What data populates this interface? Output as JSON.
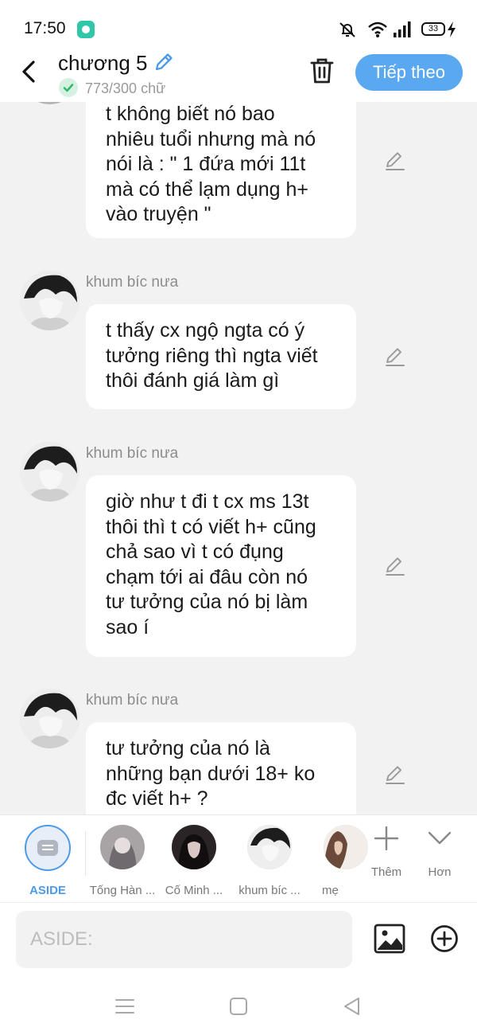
{
  "status_bar": {
    "time": "17:50",
    "battery": "33"
  },
  "header": {
    "title": "chương 5",
    "char_count": "773/300 chữ",
    "next_label": "Tiếp theo"
  },
  "messages": [
    {
      "text": "t không biết nó bao\nnhiêu tuổi nhưng mà nó\nnói là : \" 1 đứa mới 11t\nmà có thể lạm dụng h+\nvào truyện \""
    },
    {
      "sender": "khum bíc nưa",
      "text": "t thấy cx ngộ ngta có ý\ntưởng riêng thì ngta viết\nthôi đánh giá làm gì"
    },
    {
      "sender": "khum bíc nưa",
      "text": "giờ như t đi t cx ms 13t\nthôi thì t có viết h+ cũng\nchả sao vì t có đụng\nchạm tới ai đâu còn nó\ntư tưởng của nó bị làm\nsao í"
    },
    {
      "sender": "khum bíc nưa",
      "text": "tư tưởng của nó là\nnhững bạn dưới 18+ ko\nđc viết h+ ?"
    }
  ],
  "characters": {
    "aside_label": "ASIDE",
    "items": [
      {
        "name": "Tống Hàn ..."
      },
      {
        "name": "Cố Minh ..."
      },
      {
        "name": "khum bíc ..."
      },
      {
        "name": "mẹ"
      }
    ],
    "more_label": "Thêm",
    "expand_label": "Hơn"
  },
  "input": {
    "placeholder": "ASIDE:"
  },
  "colors": {
    "accent": "#5aa9f0",
    "aside_blue": "#4c9ae8",
    "background": "#f2f2f2"
  },
  "icons": [
    "back-arrow-icon",
    "pencil-icon",
    "check-icon",
    "trash-icon",
    "edit-icon",
    "plus-icon",
    "chevron-down-icon",
    "image-icon",
    "add-circle-icon",
    "menu-icon",
    "home-square-icon",
    "back-triangle-icon"
  ]
}
